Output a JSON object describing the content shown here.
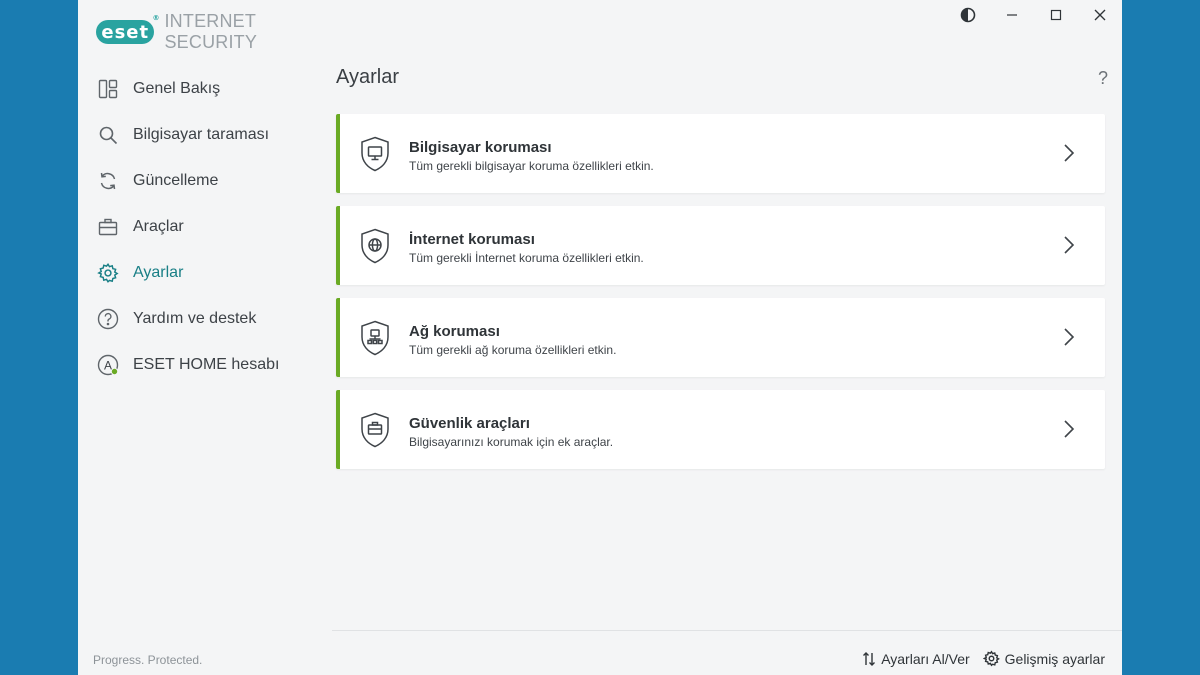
{
  "app": {
    "brand": "eset",
    "brand_mark": "®",
    "product": "INTERNET SECURITY",
    "tagline": "Progress. Protected."
  },
  "window_controls": {
    "theme_icon": "contrast-icon",
    "minimize_icon": "minimize-icon",
    "maximize_icon": "maximize-icon",
    "close_icon": "close-icon"
  },
  "sidebar": {
    "items": [
      {
        "label": "Genel Bakış",
        "icon": "dashboard-icon"
      },
      {
        "label": "Bilgisayar taraması",
        "icon": "search-icon"
      },
      {
        "label": "Güncelleme",
        "icon": "refresh-icon"
      },
      {
        "label": "Araçlar",
        "icon": "toolbox-icon"
      },
      {
        "label": "Ayarlar",
        "icon": "gear-icon",
        "active": true
      },
      {
        "label": "Yardım ve destek",
        "icon": "help-circle-icon"
      },
      {
        "label": "ESET HOME hesabı",
        "icon": "account-icon"
      }
    ]
  },
  "main": {
    "title": "Ayarlar",
    "help": "?",
    "cards": [
      {
        "title": "Bilgisayar koruması",
        "desc": "Tüm gerekli bilgisayar koruma özellikleri etkin.",
        "icon": "shield-monitor-icon"
      },
      {
        "title": "İnternet koruması",
        "desc": "Tüm gerekli İnternet koruma özellikleri etkin.",
        "icon": "shield-globe-icon"
      },
      {
        "title": "Ağ koruması",
        "desc": "Tüm gerekli ağ koruma özellikleri etkin.",
        "icon": "shield-network-icon"
      },
      {
        "title": "Güvenlik araçları",
        "desc": "Bilgisayarınızı korumak için ek araçlar.",
        "icon": "shield-briefcase-icon"
      }
    ],
    "footer": {
      "import_export": "Ayarları Al/Ver",
      "advanced": "Gelişmiş ayarlar"
    }
  },
  "colors": {
    "accent": "#197f86",
    "brand": "#29a3a0",
    "status_ok": "#6aaa24",
    "background": "#1a7cb1"
  }
}
